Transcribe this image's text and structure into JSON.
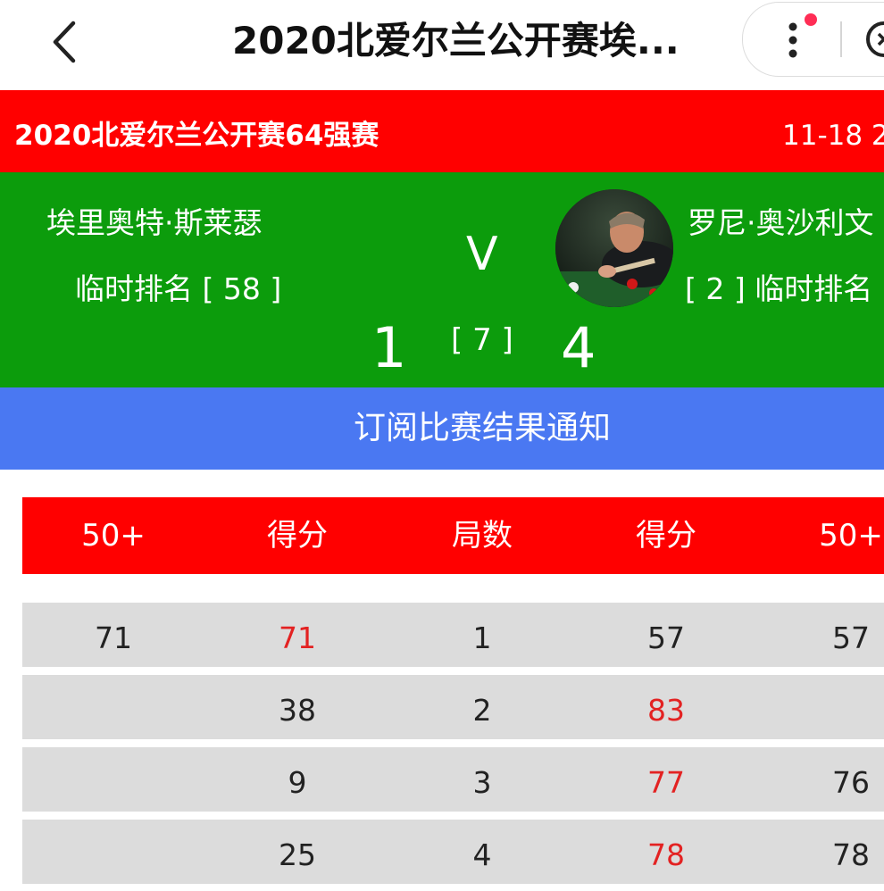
{
  "navbar": {
    "title": "2020北爱尔兰公开赛埃..."
  },
  "match": {
    "name": "2020北爱尔兰公开赛64强赛",
    "date": "11-18 2"
  },
  "player1": {
    "name": "埃里奥特·斯莱瑟",
    "rank": "临时排名 [ 58 ]",
    "score": "1"
  },
  "player2": {
    "name": "罗尼·奥沙利文",
    "rank": "[ 2 ] 临时排名",
    "score": "4"
  },
  "versus": "V",
  "best_of": "[ 7 ]",
  "subscribe_label": "订阅比赛结果通知",
  "table": {
    "headers": [
      "50+",
      "得分",
      "局数",
      "得分",
      "50+"
    ],
    "rows": [
      [
        "71",
        "71",
        "1",
        "57",
        "57"
      ],
      [
        "",
        "38",
        "2",
        "83",
        ""
      ],
      [
        "",
        "9",
        "3",
        "77",
        "76"
      ],
      [
        "",
        "25",
        "4",
        "78",
        "78"
      ]
    ],
    "frame_winner": [
      "left",
      "right",
      "right",
      "right"
    ]
  },
  "colors": {
    "header_red": "#ff0000",
    "panel_green": "#0c9c0c",
    "subscribe_blue": "#4a78f2",
    "row_gray": "#dcdcdc",
    "winner_red": "#e32222"
  }
}
